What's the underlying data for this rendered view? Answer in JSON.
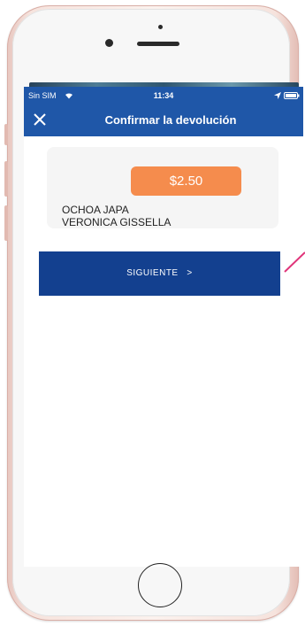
{
  "status_bar": {
    "carrier": "Sin SIM",
    "time": "11:34",
    "wifi_icon": "wifi-icon",
    "location_icon": "location-arrow-icon",
    "battery_icon": "battery-icon"
  },
  "header": {
    "title": "Confirmar la devolución",
    "close_icon": "close-icon",
    "background_color": "#1f57a8"
  },
  "card": {
    "amount": "$2.50",
    "name_line1": "OCHOA JAPA",
    "name_line2": "VERONICA GISSELLA",
    "amount_color": "#f58c4d"
  },
  "actions": {
    "next_label": "SIGUIENTE   >",
    "next_color": "#13408f"
  }
}
